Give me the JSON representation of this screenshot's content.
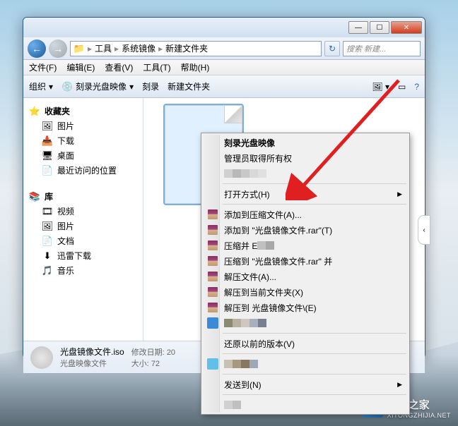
{
  "window": {
    "controls": {
      "min": "—",
      "max": "☐",
      "close": "✕"
    }
  },
  "breadcrumb": {
    "icon": "📁",
    "items": [
      "工具",
      "系统镜像",
      "新建文件夹"
    ]
  },
  "search": {
    "placeholder": "搜索 新建..."
  },
  "menubar": {
    "file": "文件(F)",
    "edit": "编辑(E)",
    "view": "查看(V)",
    "tools": "工具(T)",
    "help": "帮助(H)"
  },
  "toolbar": {
    "organize": "组织",
    "burn": "刻录光盘映像",
    "burn2": "刻录",
    "newfolder": "新建文件夹"
  },
  "sidebar": {
    "fav_header": "收藏夹",
    "fav": {
      "pictures": "图片",
      "downloads": "下载",
      "desktop": "桌面",
      "recent": "最近访问的位置"
    },
    "lib_header": "库",
    "lib": {
      "videos": "视频",
      "pictures": "图片",
      "docs": "文档",
      "xunlei": "迅雷下载",
      "music": "音乐"
    }
  },
  "details": {
    "name": "光盘镜像文件.iso",
    "type": "光盘映像文件",
    "date_label": "修改日期:",
    "date_val": "20",
    "size_label": "大小:",
    "size_val": "72"
  },
  "context": {
    "burn": "刻录光盘映像",
    "admin": "管理员取得所有权",
    "blur1": "",
    "openwith": "打开方式(H)",
    "addarchive": "添加到压缩文件(A)...",
    "addrar": "添加到 \"光盘镜像文件.rar\"(T)",
    "compress_email": "压缩并 E",
    "compress_rar_email": "压缩到 \"光盘镜像文件.rar\" 并",
    "extract": "解压文件(A)...",
    "extract_here": "解压到当前文件夹(X)",
    "extract_to": "解压到 光盘镜像文件\\(E)",
    "blur2": "",
    "restore": "还原以前的版本(V)",
    "blur3": "",
    "sendto": "发送到(N)",
    "blur4": ""
  },
  "watermark": {
    "brand": "系统之家",
    "url": "XITONGZHIJIA.NET"
  }
}
